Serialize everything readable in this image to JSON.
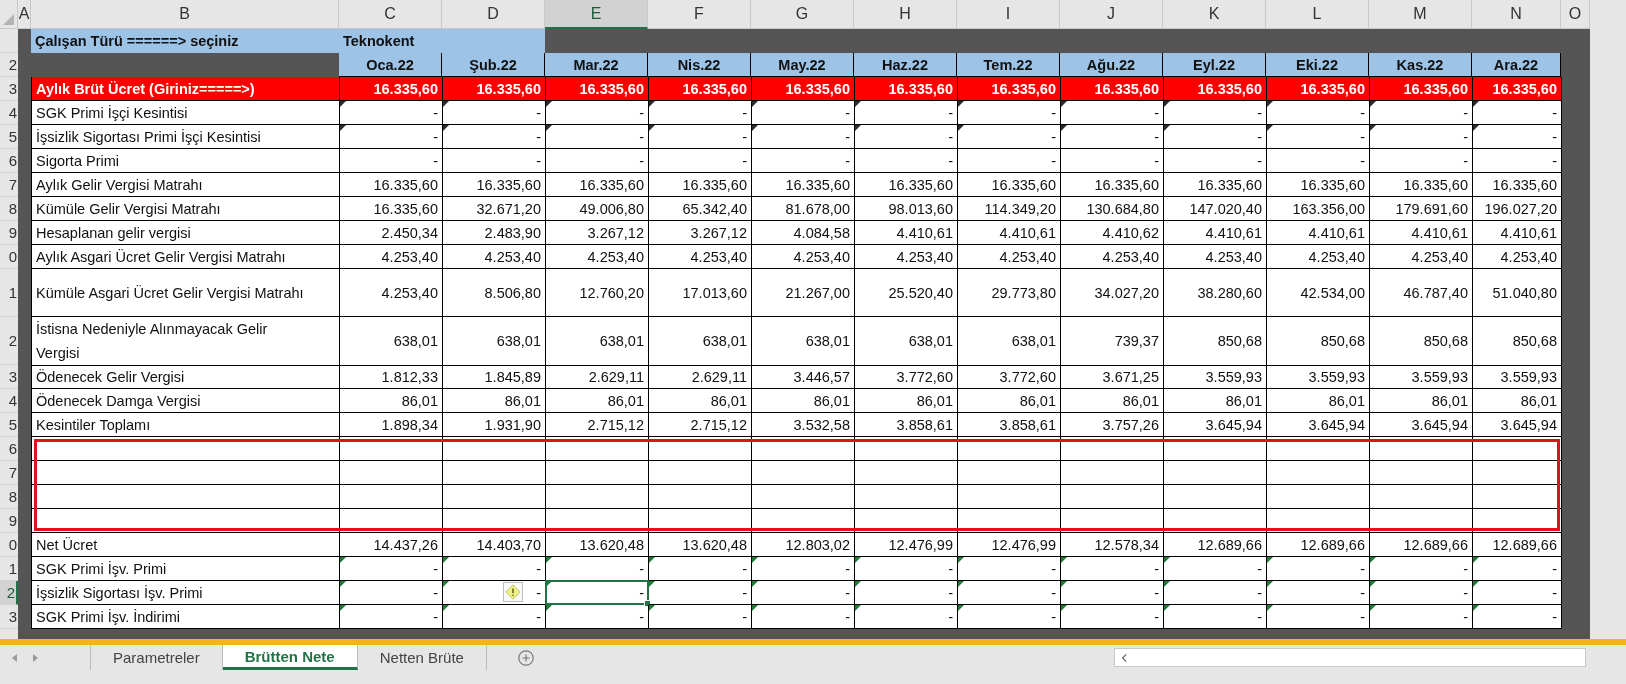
{
  "column_headers": [
    {
      "label": "A",
      "selected": false
    },
    {
      "label": "B",
      "selected": false
    },
    {
      "label": "C",
      "selected": false
    },
    {
      "label": "D",
      "selected": false
    },
    {
      "label": "E",
      "selected": true
    },
    {
      "label": "F",
      "selected": false
    },
    {
      "label": "G",
      "selected": false
    },
    {
      "label": "H",
      "selected": false
    },
    {
      "label": "I",
      "selected": false
    },
    {
      "label": "J",
      "selected": false
    },
    {
      "label": "K",
      "selected": false
    },
    {
      "label": "L",
      "selected": false
    },
    {
      "label": "M",
      "selected": false
    },
    {
      "label": "N",
      "selected": false
    },
    {
      "label": "O",
      "selected": false
    }
  ],
  "title_row": {
    "label": "Çalışan Türü ======> seçiniz",
    "value": "Teknokent"
  },
  "month_row": {
    "row_number": "2",
    "months": [
      "Oca.22",
      "Şub.22",
      "Mar.22",
      "Nis.22",
      "May.22",
      "Haz.22",
      "Tem.22",
      "Ağu.22",
      "Eyl.22",
      "Eki.22",
      "Kas.22",
      "Ara.22"
    ]
  },
  "gross_row": {
    "row_number": "3",
    "label": "Aylık Brüt Ücret (Giriniz=====>)",
    "values": [
      "16.335,60",
      "16.335,60",
      "16.335,60",
      "16.335,60",
      "16.335,60",
      "16.335,60",
      "16.335,60",
      "16.335,60",
      "16.335,60",
      "16.335,60",
      "16.335,60",
      "16.335,60"
    ]
  },
  "rows": [
    {
      "row_number": "4",
      "label": "SGK Primi İşçi Kesintisi",
      "color": "#2b2b2b",
      "selected": false,
      "framed": false,
      "values": [
        "-",
        "-",
        "-",
        "-",
        "-",
        "-",
        "-",
        "-",
        "-",
        "-",
        "-",
        "-"
      ]
    },
    {
      "row_number": "5",
      "label": "İşsizlik Sigortası Primi İşçi Kesintisi",
      "color": "#2b2b2b",
      "selected": false,
      "framed": false,
      "values": [
        "-",
        "-",
        "-",
        "-",
        "-",
        "-",
        "-",
        "-",
        "-",
        "-",
        "-",
        "-"
      ]
    },
    {
      "row_number": "6",
      "label": "Sigorta Primi",
      "selected": false,
      "framed": false,
      "values": [
        "-",
        "-",
        "-",
        "-",
        "-",
        "-",
        "-",
        "-",
        "-",
        "-",
        "-",
        "-"
      ]
    },
    {
      "row_number": "7",
      "label": "Aylık Gelir Vergisi Matrahı",
      "selected": false,
      "framed": false,
      "values": [
        "16.335,60",
        "16.335,60",
        "16.335,60",
        "16.335,60",
        "16.335,60",
        "16.335,60",
        "16.335,60",
        "16.335,60",
        "16.335,60",
        "16.335,60",
        "16.335,60",
        "16.335,60"
      ]
    },
    {
      "row_number": "8",
      "label": "Kümüle Gelir Vergisi Matrahı",
      "selected": false,
      "framed": false,
      "values": [
        "16.335,60",
        "32.671,20",
        "49.006,80",
        "65.342,40",
        "81.678,00",
        "98.013,60",
        "114.349,20",
        "130.684,80",
        "147.020,40",
        "163.356,00",
        "179.691,60",
        "196.027,20"
      ]
    },
    {
      "row_number": "9",
      "label": "Hesaplanan gelir vergisi",
      "selected": false,
      "framed": false,
      "values": [
        "2.450,34",
        "2.483,90",
        "3.267,12",
        "3.267,12",
        "4.084,58",
        "4.410,61",
        "4.410,61",
        "4.410,62",
        "4.410,61",
        "4.410,61",
        "4.410,61",
        "4.410,61"
      ]
    },
    {
      "row_number": "0",
      "label": "Aylık Asgari Ücret Gelir Vergisi Matrahı",
      "selected": false,
      "framed": false,
      "values": [
        "4.253,40",
        "4.253,40",
        "4.253,40",
        "4.253,40",
        "4.253,40",
        "4.253,40",
        "4.253,40",
        "4.253,40",
        "4.253,40",
        "4.253,40",
        "4.253,40",
        "4.253,40"
      ]
    },
    {
      "row_number": "1",
      "label": "Kümüle Asgari Ücret Gelir Vergisi Matrahı",
      "tall": true,
      "selected": false,
      "framed": false,
      "values": [
        "4.253,40",
        "8.506,80",
        "12.760,20",
        "17.013,60",
        "21.267,00",
        "25.520,40",
        "29.773,80",
        "34.027,20",
        "38.280,60",
        "42.534,00",
        "46.787,40",
        "51.040,80"
      ]
    },
    {
      "row_number": "2",
      "label": "İstisna Nedeniyle Alınmayacak Gelir Vergisi",
      "tall": true,
      "selected": false,
      "framed": false,
      "values": [
        "638,01",
        "638,01",
        "638,01",
        "638,01",
        "638,01",
        "638,01",
        "638,01",
        "739,37",
        "850,68",
        "850,68",
        "850,68",
        "850,68"
      ]
    },
    {
      "row_number": "3",
      "label": "Ödenecek Gelir Vergisi",
      "selected": false,
      "framed": false,
      "values": [
        "1.812,33",
        "1.845,89",
        "2.629,11",
        "2.629,11",
        "3.446,57",
        "3.772,60",
        "3.772,60",
        "3.671,25",
        "3.559,93",
        "3.559,93",
        "3.559,93",
        "3.559,93"
      ]
    },
    {
      "row_number": "4",
      "label": "Ödenecek Damga Vergisi",
      "selected": false,
      "framed": false,
      "values": [
        "86,01",
        "86,01",
        "86,01",
        "86,01",
        "86,01",
        "86,01",
        "86,01",
        "86,01",
        "86,01",
        "86,01",
        "86,01",
        "86,01"
      ]
    },
    {
      "row_number": "5",
      "label": "Kesintiler Toplamı",
      "selected": false,
      "framed": false,
      "values": [
        "1.898,34",
        "1.931,90",
        "2.715,12",
        "2.715,12",
        "3.532,58",
        "3.858,61",
        "3.858,61",
        "3.757,26",
        "3.645,94",
        "3.645,94",
        "3.645,94",
        "3.645,94"
      ]
    },
    {
      "row_number": "6",
      "selected": false,
      "framed": true
    },
    {
      "row_number": "7",
      "selected": false,
      "framed": true
    },
    {
      "row_number": "8",
      "selected": false,
      "framed": true
    },
    {
      "row_number": "9",
      "selected": false,
      "framed": true
    },
    {
      "row_number": "0",
      "label": "Net Ücret",
      "selected": false,
      "framed": false,
      "values": [
        "14.437,26",
        "14.403,70",
        "13.620,48",
        "13.620,48",
        "12.803,02",
        "12.476,99",
        "12.476,99",
        "12.578,34",
        "12.689,66",
        "12.689,66",
        "12.689,66",
        "12.689,66"
      ]
    },
    {
      "row_number": "1",
      "label": "SGK Primi İşv. Primi",
      "color": "#1e7b34",
      "selected": false,
      "framed": false,
      "values": [
        "-",
        "-",
        "-",
        "-",
        "-",
        "-",
        "-",
        "-",
        "-",
        "-",
        "-",
        "-"
      ]
    },
    {
      "row_number": "2",
      "label": "İşsizlik Sigortası İşv. Primi",
      "color": "#1e7b34",
      "selected": true,
      "warning": true,
      "framed": false,
      "values": [
        "-",
        "-",
        "-",
        "-",
        "-",
        "-",
        "-",
        "-",
        "-",
        "-",
        "-",
        "-"
      ]
    },
    {
      "row_number": "3",
      "label": "SGK Primi İşv. İndirimi",
      "color": "#1e7b34",
      "selected": false,
      "framed": false,
      "values": [
        "-",
        "-",
        "-",
        "-",
        "-",
        "-",
        "-",
        "-",
        "-",
        "-",
        "-",
        "-"
      ]
    }
  ],
  "sheet_tabs": [
    {
      "label": "Parametreler",
      "selected": false
    },
    {
      "label": "Brütten Nete",
      "selected": true
    },
    {
      "label": "Netten Brüte",
      "selected": false
    }
  ]
}
